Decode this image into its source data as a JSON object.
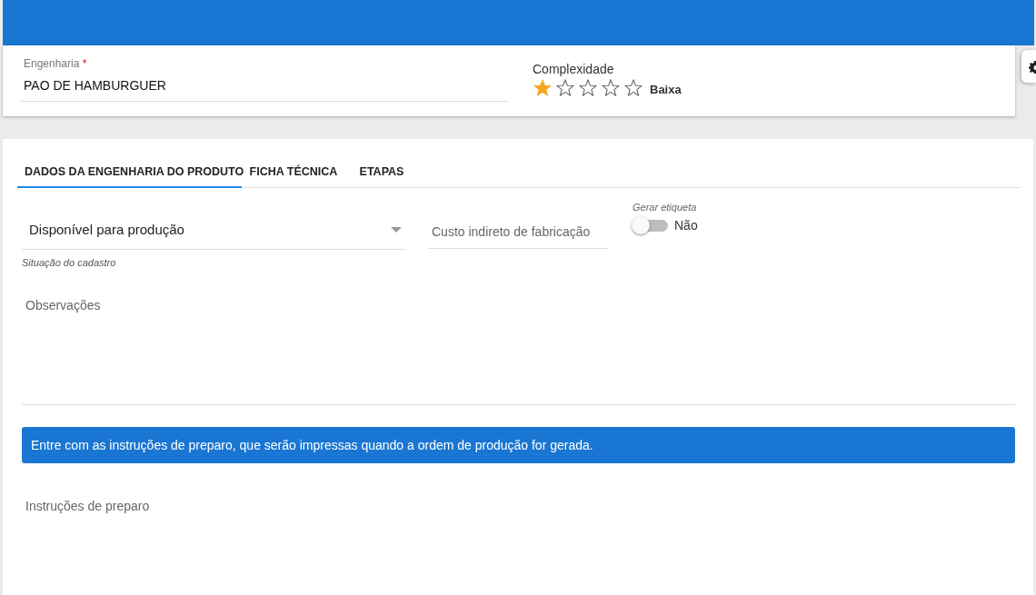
{
  "header": {
    "engineering": {
      "label": "Engenharia",
      "required_mark": "*",
      "value": "PAO DE HAMBURGUER"
    },
    "complexity": {
      "label": "Complexidade",
      "stars": 1,
      "rating_text": "Baixa"
    }
  },
  "tabs": [
    {
      "label": "DADOS DA ENGENHARIA DO PRODUTO",
      "selected": true
    },
    {
      "label": "FICHA TÉCNICA",
      "selected": false
    },
    {
      "label": "ETAPAS",
      "selected": false
    }
  ],
  "form": {
    "situation": {
      "value": "Disponível para produção",
      "helper": "Situação do cadastro"
    },
    "indirect_cost": {
      "placeholder": "Custo indireto de fabricação"
    },
    "label_toggle": {
      "label": "Gerar etiqueta",
      "on": false,
      "value_text": "Não"
    },
    "observations": {
      "placeholder": "Observações"
    },
    "info_banner": "Entre com as instruções de preparo, que serão impressas quando a ordem de produção for gerada.",
    "instructions": {
      "placeholder": "Instruções de preparo"
    }
  }
}
